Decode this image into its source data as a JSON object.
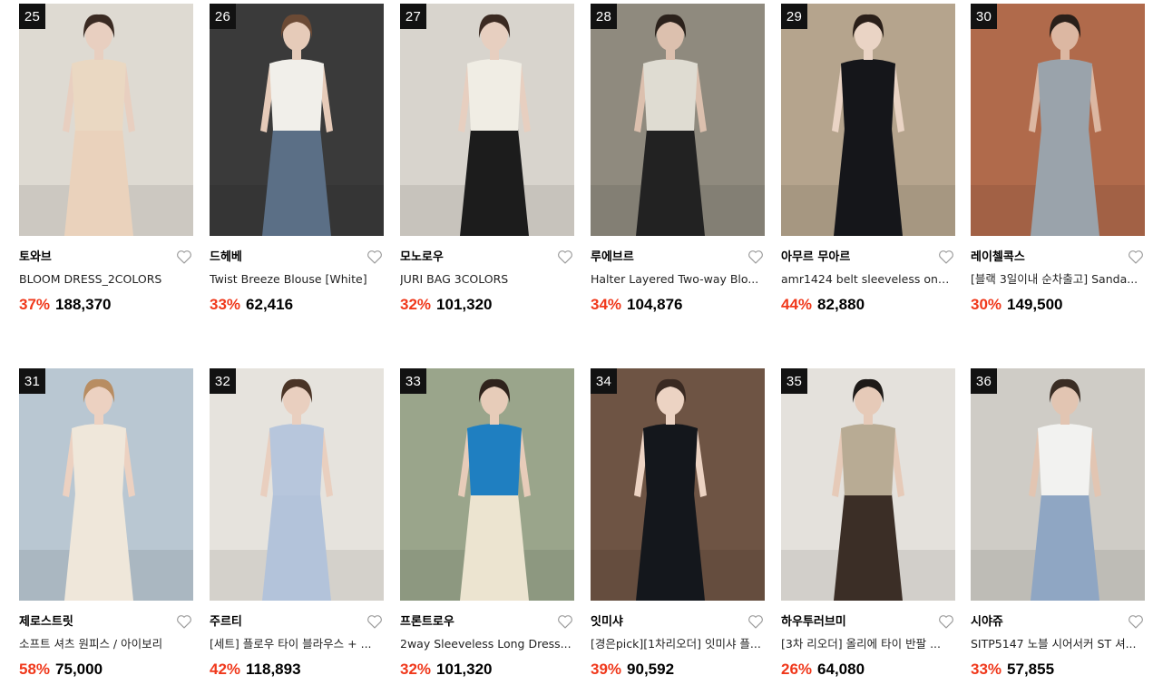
{
  "products": [
    {
      "rank": "25",
      "brand": "토와브",
      "title": "BLOOM DRESS_2COLORS",
      "discount": "37%",
      "price": "188,370",
      "bg": "#dedad2",
      "skin": "#e8cfc0",
      "hair": "#3a2a22",
      "top": "#ead8c2",
      "bottom": "#ead2bc",
      "image_icon": "dress-model-photo"
    },
    {
      "rank": "26",
      "brand": "드헤베",
      "title": "Twist Breeze Blouse [White]",
      "discount": "33%",
      "price": "62,416",
      "bg": "#3a3a3a",
      "skin": "#e6cbb9",
      "hair": "#6b4a35",
      "top": "#f1efea",
      "bottom": "#5b6f86",
      "image_icon": "blouse-model-photo"
    },
    {
      "rank": "27",
      "brand": "모노로우",
      "title": "JURI BAG 3COLORS",
      "discount": "32%",
      "price": "101,320",
      "bg": "#d8d4cd",
      "skin": "#e7cfc0",
      "hair": "#3b2a22",
      "top": "#f0ede4",
      "bottom": "#1c1c1c",
      "image_icon": "bag-model-photo"
    },
    {
      "rank": "28",
      "brand": "루에브르",
      "title": "Halter Layered Two-way Blo...",
      "discount": "34%",
      "price": "104,876",
      "bg": "#8f8a7e",
      "skin": "#dcc0ae",
      "hair": "#2b211b",
      "top": "#dfdcd2",
      "bottom": "#222222",
      "image_icon": "blouse-model-photo"
    },
    {
      "rank": "29",
      "brand": "아무르 무아르",
      "title": "amr1424 belt sleeveless one...",
      "discount": "44%",
      "price": "82,880",
      "bg": "#b5a48d",
      "skin": "#ead4c5",
      "hair": "#2a1f19",
      "top": "#15161a",
      "bottom": "#15161a",
      "image_icon": "dress-model-photo"
    },
    {
      "rank": "30",
      "brand": "레이첼콕스",
      "title": "[블랙 3일이내 순차출고] Sanda...",
      "discount": "30%",
      "price": "149,500",
      "bg": "#b06a4b",
      "skin": "#dcb7a2",
      "hair": "#2a1f19",
      "top": "#9aa3ab",
      "bottom": "#9aa3ab",
      "image_icon": "sandal-model-photo"
    },
    {
      "rank": "31",
      "brand": "제로스트릿",
      "title": "소프트 셔츠 원피스 / 아이보리",
      "discount": "58%",
      "price": "75,000",
      "bg": "#b9c7d2",
      "skin": "#ecd1c1",
      "hair": "#b88d62",
      "top": "#efe7da",
      "bottom": "#efe7da",
      "image_icon": "dress-model-photo"
    },
    {
      "rank": "32",
      "brand": "주르티",
      "title": "[세트] 플로우 타이 블라우스 + ...",
      "discount": "42%",
      "price": "118,893",
      "bg": "#e6e3dd",
      "skin": "#e9cfbf",
      "hair": "#4a3426",
      "top": "#b7c6dc",
      "bottom": "#b3c3da",
      "image_icon": "set-model-photo"
    },
    {
      "rank": "33",
      "brand": "프론트로우",
      "title": "2way Sleeveless Long Dress...",
      "discount": "32%",
      "price": "101,320",
      "bg": "#9aa58b",
      "skin": "#e7ccb9",
      "hair": "#2f231c",
      "top": "#1f7fc1",
      "bottom": "#ece4d0",
      "image_icon": "dress-model-photo"
    },
    {
      "rank": "34",
      "brand": "잇미샤",
      "title": "[경은pick][1차리오더] 잇미샤 플...",
      "discount": "39%",
      "price": "90,592",
      "bg": "#6e5444",
      "skin": "#ecd3c3",
      "hair": "#3a2a22",
      "top": "#14171c",
      "bottom": "#14171c",
      "image_icon": "dress-model-photo"
    },
    {
      "rank": "35",
      "brand": "하우투러브미",
      "title": "[3차 리오더] 올리에 타이 반팔 ...",
      "discount": "26%",
      "price": "64,080",
      "bg": "#e4e1dc",
      "skin": "#e6cab8",
      "hair": "#1e1a18",
      "top": "#b8ab94",
      "bottom": "#3b2e26",
      "image_icon": "blouse-model-photo"
    },
    {
      "rank": "36",
      "brand": "시야쥬",
      "title": "SITP5147 노블 시어서커 ST 셔...",
      "discount": "33%",
      "price": "57,855",
      "bg": "#cfccc6",
      "skin": "#e2c5b2",
      "hair": "#3a2d24",
      "top": "#f2f2f0",
      "bottom": "#8fa6c3",
      "image_icon": "shirt-model-photo"
    }
  ],
  "colors": {
    "discount": "#f0381b",
    "rank_badge_bg": "#121212",
    "heart_stroke": "#9b9b9b"
  },
  "icons": {
    "wishlist": "heart-outline-icon"
  }
}
